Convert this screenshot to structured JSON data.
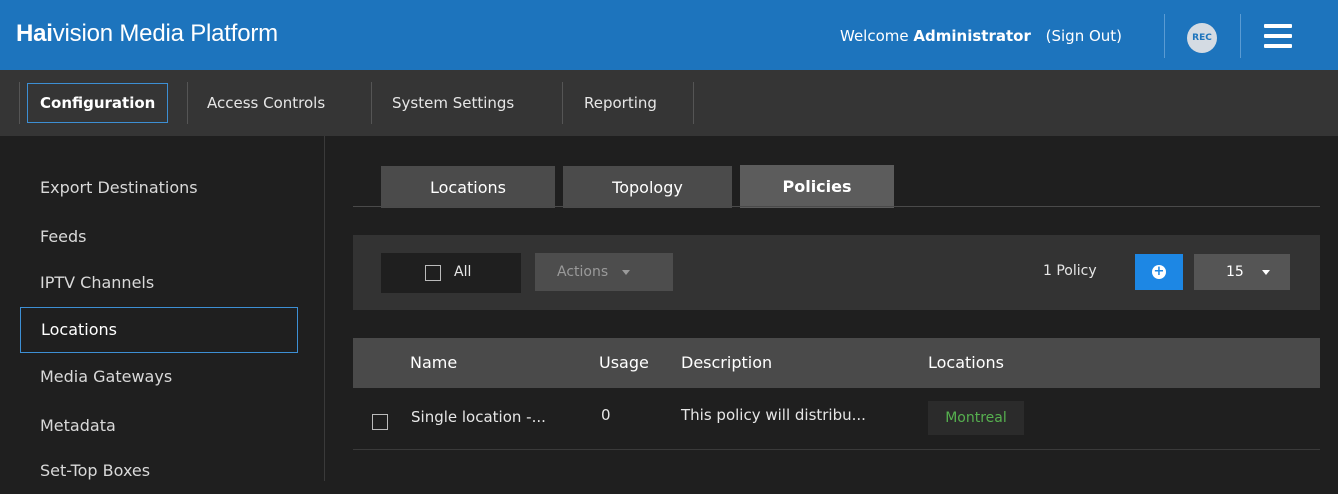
{
  "header": {
    "brand_bold": "Hai",
    "brand_rest": "vision Media Platform",
    "welcome": "Welcome",
    "user": "Administrator",
    "signout": "(Sign Out)",
    "rec_label": "REC",
    "menu_icon": "hamburger-menu-icon"
  },
  "topnav": {
    "items": [
      {
        "label": "Configuration",
        "active": true
      },
      {
        "label": "Access Controls"
      },
      {
        "label": "System Settings"
      },
      {
        "label": "Reporting"
      }
    ]
  },
  "sidebar": {
    "items": [
      {
        "label": "Export Destinations"
      },
      {
        "label": "Feeds"
      },
      {
        "label": "IPTV Channels"
      },
      {
        "label": "Locations",
        "active": true
      },
      {
        "label": "Media Gateways"
      },
      {
        "label": "Metadata"
      },
      {
        "label": "Set-Top Boxes"
      }
    ]
  },
  "tabs": [
    {
      "label": "Locations"
    },
    {
      "label": "Topology"
    },
    {
      "label": "Policies",
      "active": true
    }
  ],
  "toolbar": {
    "all_label": "All",
    "actions_label": "Actions",
    "count": "1 Policy",
    "add_icon": "plus-circle-icon",
    "page_size": "15"
  },
  "table": {
    "columns": [
      "Name",
      "Usage",
      "Description",
      "Locations"
    ],
    "rows": [
      {
        "name": "Single location -...",
        "usage": "0",
        "description": "This policy will distribu...",
        "location": "Montreal"
      }
    ]
  },
  "colors": {
    "header_bg": "#1d74bd",
    "accent": "#1d87e4",
    "location_badge_text": "#56b04f"
  }
}
